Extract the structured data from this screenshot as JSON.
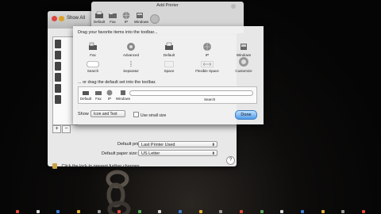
{
  "prefs": {
    "show_all": "Show All",
    "default_printer_label": "Default printer:",
    "default_printer_value": "Last Printer Used",
    "paper_size_label": "Default paper size:",
    "paper_size_value": "US Letter",
    "lock_text": "Click the lock to prevent further changes.",
    "help": "?"
  },
  "add_printer": {
    "title": "Add Printer",
    "toolbar": [
      "Default",
      "Fax",
      "IP",
      "Windows"
    ],
    "search_label": "Search"
  },
  "customize": {
    "drag_items": "Drag your favorite items into the toolbar...",
    "items": [
      {
        "label": "Fax",
        "icon": "fax-icon"
      },
      {
        "label": "Advanced",
        "icon": "gear-icon"
      },
      {
        "label": "Default",
        "icon": "printer-icon"
      },
      {
        "label": "IP",
        "icon": "globe-icon"
      },
      {
        "label": "Windows",
        "icon": "windows-icon"
      },
      {
        "label": "Search",
        "icon": "search-field-icon"
      },
      {
        "label": "Separator",
        "icon": "separator-icon"
      },
      {
        "label": "Space",
        "icon": "space-icon"
      },
      {
        "label": "Flexible Space",
        "icon": "flexible-space-icon"
      },
      {
        "label": "Customize",
        "icon": "customize-icon"
      }
    ],
    "drag_default": "... or drag the default set into the toolbar.",
    "default_set": [
      "Default",
      "Fax",
      "IP",
      "Windows"
    ],
    "default_search": "Search",
    "show_label": "Show",
    "show_value": "Icon and Text",
    "use_small_size": "Use small size",
    "done": "Done"
  },
  "colors": {
    "done_button": "#4f9be8",
    "traffic_close": "#e0443e",
    "traffic_min": "#dea123",
    "traffic_zoom": "#1aab29"
  }
}
